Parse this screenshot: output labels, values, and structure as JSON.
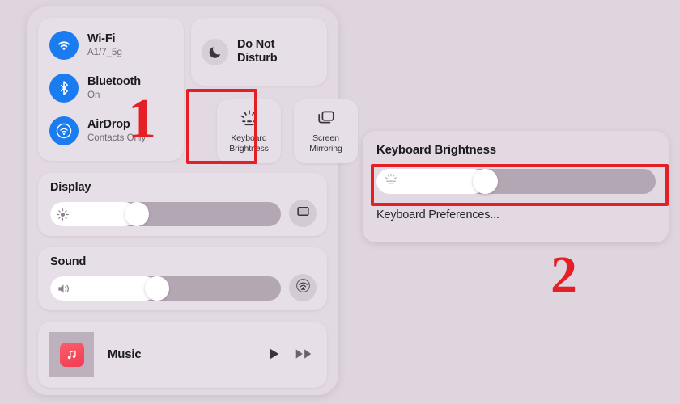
{
  "background_color": "#ded5de",
  "control_center": {
    "connectivity": [
      {
        "icon": "wifi-icon",
        "title": "Wi-Fi",
        "subtitle": "A1/7_5g"
      },
      {
        "icon": "bluetooth-icon",
        "title": "Bluetooth",
        "subtitle": "On"
      },
      {
        "icon": "airdrop-icon",
        "title": "AirDrop",
        "subtitle": "Contacts Only"
      }
    ],
    "do_not_disturb": {
      "icon": "moon-icon",
      "label": "Do Not\nDisturb",
      "line1": "Do Not",
      "line2": "Disturb"
    },
    "tiles": [
      {
        "icon": "keyboard-brightness-icon",
        "line1": "Keyboard",
        "line2": "Brightness"
      },
      {
        "icon": "screen-mirroring-icon",
        "line1": "Screen",
        "line2": "Mirroring"
      }
    ],
    "sliders": [
      {
        "name": "display",
        "heading": "Display",
        "glyph": "brightness-sun-icon",
        "value_percent": 36,
        "trailing_icon": "display-monitor-icon"
      },
      {
        "name": "sound",
        "heading": "Sound",
        "glyph": "speaker-icon",
        "value_percent": 46,
        "trailing_icon": "airplay-audio-icon"
      }
    ],
    "music": {
      "title": "Music",
      "artwork_icon": "music-app-icon",
      "play_icon": "play-icon",
      "next_icon": "fast-forward-icon"
    }
  },
  "keyboard_brightness_popup": {
    "title": "Keyboard Brightness",
    "slider": {
      "glyph": "keyboard-brightness-icon",
      "value_percent": 38
    },
    "preferences_link": "Keyboard Preferences..."
  },
  "annotations": {
    "accent_color": "#e41f26",
    "marker_one": "1",
    "marker_two": "2"
  }
}
